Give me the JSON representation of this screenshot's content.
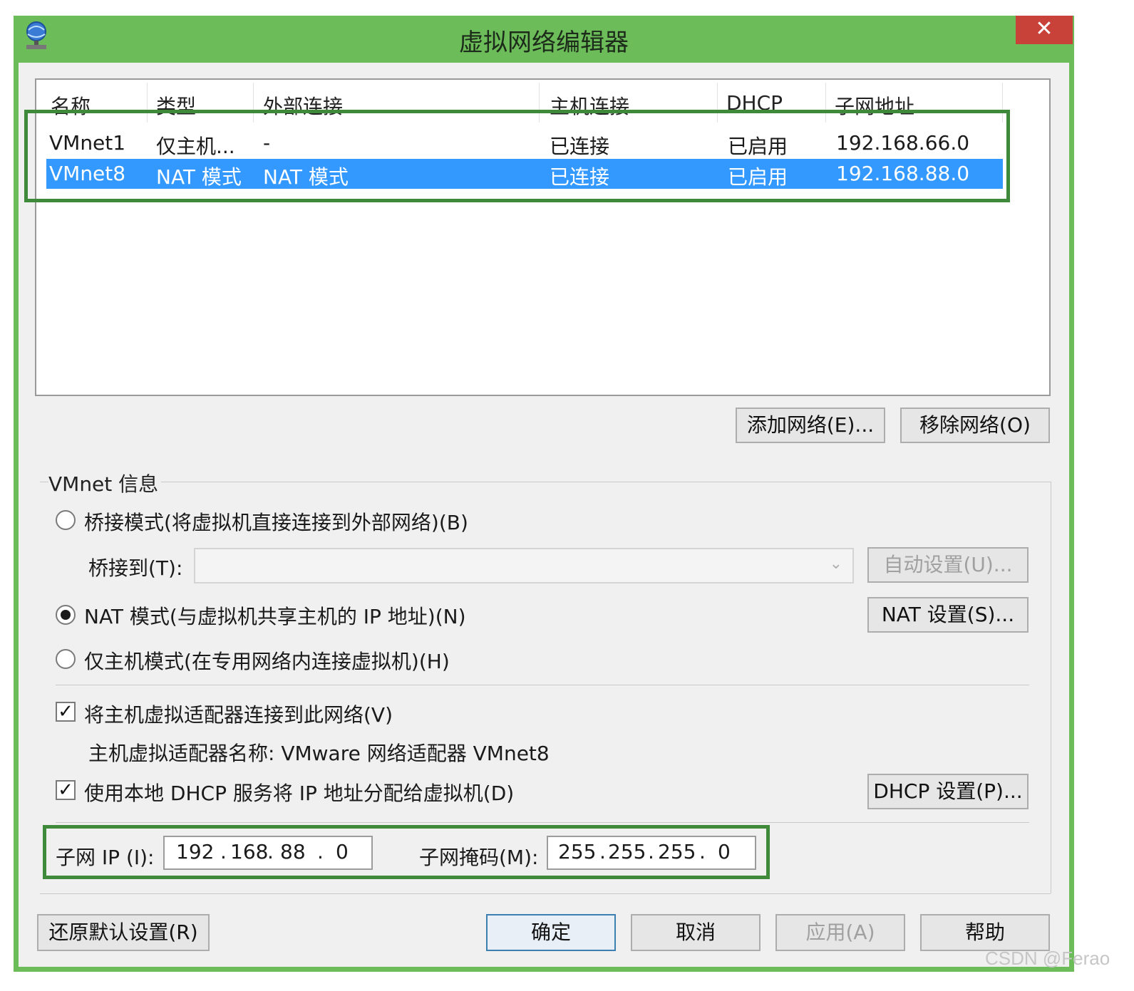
{
  "window": {
    "title": "虚拟网络编辑器",
    "close_label": "✕"
  },
  "list": {
    "columns": [
      "名称",
      "类型",
      "外部连接",
      "主机连接",
      "DHCP",
      "子网地址"
    ],
    "rows": [
      {
        "name": "VMnet1",
        "type": "仅主机...",
        "external": "-",
        "host": "已连接",
        "dhcp": "已启用",
        "subnet": "192.168.66.0",
        "selected": false
      },
      {
        "name": "VMnet8",
        "type": "NAT 模式",
        "external": "NAT 模式",
        "host": "已连接",
        "dhcp": "已启用",
        "subnet": "192.168.88.0",
        "selected": true
      }
    ]
  },
  "buttons": {
    "add_network": "添加网络(E)...",
    "remove_network": "移除网络(O)",
    "auto_settings": "自动设置(U)...",
    "nat_settings": "NAT 设置(S)...",
    "dhcp_settings": "DHCP 设置(P)...",
    "restore_defaults": "还原默认设置(R)",
    "ok": "确定",
    "cancel": "取消",
    "apply": "应用(A)",
    "help": "帮助"
  },
  "vmnet_info": {
    "group_label": "VMnet 信息",
    "bridged_label": "桥接模式(将虚拟机直接连接到外部网络)(B)",
    "bridged_to_label": "桥接到(T):",
    "bridged_to_value": "",
    "nat_label": "NAT 模式(与虚拟机共享主机的 IP 地址)(N)",
    "hostonly_label": "仅主机模式(在专用网络内连接虚拟机)(H)",
    "selected_mode": "nat",
    "connect_adapter_label": "将主机虚拟适配器连接到此网络(V)",
    "connect_adapter_checked": true,
    "adapter_name_label": "主机虚拟适配器名称: VMware 网络适配器 VMnet8",
    "use_dhcp_label": "使用本地 DHCP 服务将 IP 地址分配给虚拟机(D)",
    "use_dhcp_checked": true,
    "subnet_ip_label": "子网 IP (I):",
    "subnet_ip": [
      "192",
      "168",
      "88",
      "0"
    ],
    "subnet_mask_label": "子网掩码(M):",
    "subnet_mask": [
      "255",
      "255",
      "255",
      "0"
    ]
  },
  "watermark": "CSDN @Ferao",
  "colors": {
    "title_bar": "#6cbd5a",
    "close": "#c9423a",
    "selection": "#3399ff",
    "highlight_box": "#3f8a3a"
  }
}
